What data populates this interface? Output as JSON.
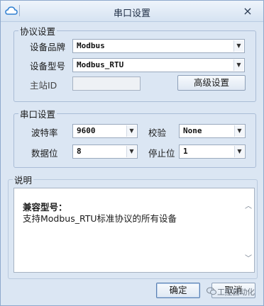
{
  "window": {
    "title": "串口设置",
    "close_symbol": "×",
    "app_icon": "cloud-icon"
  },
  "protocol_group": {
    "legend": "协议设置",
    "brand_label": "设备品牌",
    "brand_value": "Modbus",
    "model_label": "设备型号",
    "model_value": "Modbus_RTU",
    "master_id_label": "主站ID",
    "master_id_value": "",
    "advanced_button": "高级设置"
  },
  "serial_group": {
    "legend": "串口设置",
    "baud_label": "波特率",
    "baud_value": "9600",
    "parity_label": "校验",
    "parity_value": "None",
    "databits_label": "数据位",
    "databits_value": "8",
    "stopbits_label": "停止位",
    "stopbits_value": "1"
  },
  "description_group": {
    "legend": "说明",
    "compat_title": "兼容型号：",
    "compat_text": "支持Modbus_RTU标准协议的所有设备"
  },
  "footer": {
    "ok_button": "确定",
    "cancel_button": "取消",
    "watermark": "工控自动化"
  },
  "icons": {
    "dropdown": "chevron-down-icon",
    "scroll_up": "scroll-up-icon",
    "scroll_down": "scroll-down-icon"
  },
  "colors": {
    "window_bg": "#dbe6f3",
    "border": "#a9bcd6",
    "input_bg": "#ffffff"
  }
}
